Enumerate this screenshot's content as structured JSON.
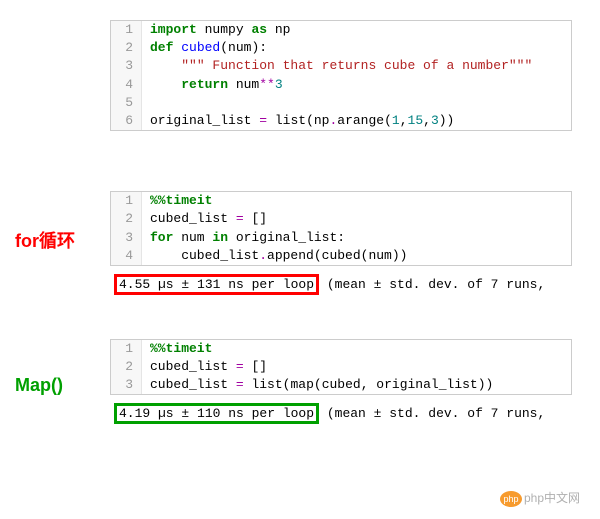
{
  "block_top": {
    "lines": [
      {
        "n": "1",
        "html": "<span class='kw'>import</span> <span class='id'>numpy</span> <span class='kw'>as</span> <span class='id'>np</span>"
      },
      {
        "n": "2",
        "html": "<span class='kw'>def</span> <span class='blue'>cubed</span>(num):"
      },
      {
        "n": "3",
        "html": "    <span class='str'>\"\"\" Function that returns cube of a number\"\"\"</span>"
      },
      {
        "n": "4",
        "html": "    <span class='kw'>return</span> num<span class='op'>**</span><span class='num'>3</span>"
      },
      {
        "n": "5",
        "html": ""
      },
      {
        "n": "6",
        "html": "original_list <span class='op'>=</span> <span class='call'>list</span>(np<span class='op'>.</span>arange(<span class='num'>1</span>,<span class='num'>15</span>,<span class='num'>3</span>))"
      }
    ]
  },
  "block_for": {
    "label": "for循环",
    "lines": [
      {
        "n": "1",
        "html": "<span class='mag'>%%timeit</span>"
      },
      {
        "n": "2",
        "html": "cubed_list <span class='op'>=</span> []"
      },
      {
        "n": "3",
        "html": "<span class='kw'>for</span> num <span class='kw'>in</span> original_list:"
      },
      {
        "n": "4",
        "html": "    cubed_list<span class='op'>.</span>append(cubed(num))"
      }
    ],
    "output_hl": "4.55 µs ± 131 ns per loop",
    "output_rest": " (mean ± std. dev. of 7 runs,"
  },
  "block_map": {
    "label": "Map()",
    "lines": [
      {
        "n": "1",
        "html": "<span class='mag'>%%timeit</span>"
      },
      {
        "n": "2",
        "html": "cubed_list <span class='op'>=</span> []"
      },
      {
        "n": "3",
        "html": "cubed_list <span class='op'>=</span> <span class='call'>list</span>(<span class='call'>map</span>(cubed, original_list))"
      }
    ],
    "output_hl": "4.19 µs ± 110 ns per loop",
    "output_rest": " (mean ± std. dev. of 7 runs,"
  },
  "watermark": "php中文网"
}
